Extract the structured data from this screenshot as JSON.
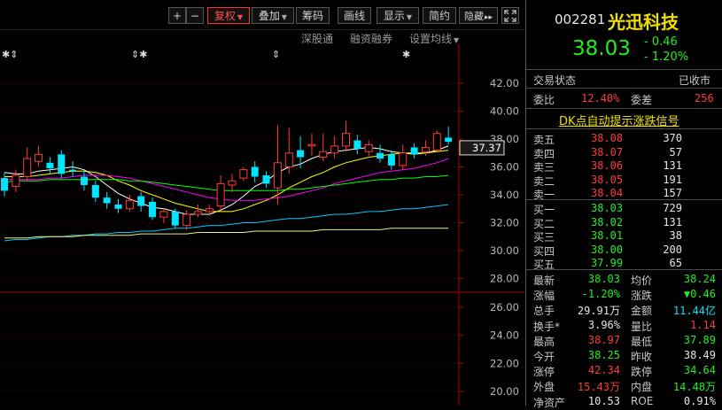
{
  "toolbar": {
    "plus": "+",
    "minus": "−",
    "fuquan": "复权",
    "diejia": "叠加",
    "chouma": "筹码",
    "huaxian": "画线",
    "xianshi": "显示",
    "jianyue": "简约",
    "yincang": "隐藏",
    "fullscreen_icon": "expand-icon"
  },
  "sublinks": {
    "shengutong": "深股通",
    "rongzi": "融资融券",
    "shezhi": "设置均线"
  },
  "markers": [
    "✱⇕",
    "⇕✱",
    "⇕",
    "✱"
  ],
  "axis": {
    "upper_ticks": [
      "42.00",
      "40.00",
      "38.00",
      "36.00",
      "34.00",
      "32.00",
      "30.00",
      "28.00"
    ],
    "lower_ticks": [
      "26.00",
      "24.00",
      "22.00",
      "20.00"
    ],
    "current_price_label": "37.37"
  },
  "chart_data": {
    "type": "candlestick",
    "ylim": [
      28,
      43
    ],
    "candles": [
      {
        "o": 35.2,
        "c": 34.3,
        "h": 35.6,
        "l": 33.9
      },
      {
        "o": 34.6,
        "c": 35.4,
        "h": 35.8,
        "l": 34.2
      },
      {
        "o": 35.3,
        "c": 36.6,
        "h": 37.4,
        "l": 35.0
      },
      {
        "o": 36.4,
        "c": 36.9,
        "h": 37.5,
        "l": 36.0
      },
      {
        "o": 36.3,
        "c": 35.9,
        "h": 36.7,
        "l": 35.5
      },
      {
        "o": 36.9,
        "c": 35.5,
        "h": 37.2,
        "l": 35.2
      },
      {
        "o": 35.8,
        "c": 35.7,
        "h": 36.4,
        "l": 35.3
      },
      {
        "o": 35.3,
        "c": 34.7,
        "h": 35.8,
        "l": 34.3
      },
      {
        "o": 34.7,
        "c": 33.8,
        "h": 35.0,
        "l": 33.5
      },
      {
        "o": 33.8,
        "c": 33.4,
        "h": 34.2,
        "l": 33.0
      },
      {
        "o": 33.3,
        "c": 33.0,
        "h": 33.7,
        "l": 32.7
      },
      {
        "o": 33.0,
        "c": 33.6,
        "h": 34.0,
        "l": 32.8
      },
      {
        "o": 33.9,
        "c": 33.2,
        "h": 34.2,
        "l": 32.8
      },
      {
        "o": 33.5,
        "c": 32.4,
        "h": 33.8,
        "l": 32.2
      },
      {
        "o": 32.4,
        "c": 32.8,
        "h": 33.0,
        "l": 32.0
      },
      {
        "o": 32.8,
        "c": 31.8,
        "h": 33.0,
        "l": 31.6
      },
      {
        "o": 31.8,
        "c": 32.6,
        "h": 32.9,
        "l": 31.5
      },
      {
        "o": 32.6,
        "c": 32.8,
        "h": 33.3,
        "l": 32.4
      },
      {
        "o": 32.8,
        "c": 33.0,
        "h": 33.3,
        "l": 32.5
      },
      {
        "o": 33.2,
        "c": 34.8,
        "h": 35.4,
        "l": 32.9
      },
      {
        "o": 34.7,
        "c": 35.0,
        "h": 35.5,
        "l": 34.2
      },
      {
        "o": 35.2,
        "c": 35.8,
        "h": 36.0,
        "l": 35.0
      },
      {
        "o": 36.0,
        "c": 35.3,
        "h": 36.4,
        "l": 34.9
      },
      {
        "o": 35.4,
        "c": 34.8,
        "h": 35.7,
        "l": 34.5
      },
      {
        "o": 34.5,
        "c": 36.3,
        "h": 39.0,
        "l": 33.3
      },
      {
        "o": 36.0,
        "c": 37.0,
        "h": 38.8,
        "l": 35.5
      },
      {
        "o": 37.2,
        "c": 36.7,
        "h": 38.2,
        "l": 35.9
      },
      {
        "o": 37.5,
        "c": 37.6,
        "h": 38.4,
        "l": 36.8
      },
      {
        "o": 36.7,
        "c": 37.1,
        "h": 38.4,
        "l": 36.4
      },
      {
        "o": 37.0,
        "c": 37.5,
        "h": 38.2,
        "l": 36.6
      },
      {
        "o": 37.5,
        "c": 38.4,
        "h": 39.3,
        "l": 37.1
      },
      {
        "o": 37.9,
        "c": 37.3,
        "h": 38.3,
        "l": 36.9
      },
      {
        "o": 37.1,
        "c": 37.6,
        "h": 37.9,
        "l": 36.8
      },
      {
        "o": 37.0,
        "c": 36.6,
        "h": 37.6,
        "l": 36.3
      },
      {
        "o": 36.9,
        "c": 36.1,
        "h": 37.2,
        "l": 35.8
      },
      {
        "o": 36.1,
        "c": 37.0,
        "h": 37.6,
        "l": 35.8
      },
      {
        "o": 37.4,
        "c": 36.9,
        "h": 37.7,
        "l": 36.6
      },
      {
        "o": 37.1,
        "c": 37.4,
        "h": 37.9,
        "l": 36.8
      },
      {
        "o": 37.2,
        "c": 38.4,
        "h": 38.6,
        "l": 37.1
      },
      {
        "o": 38.1,
        "c": 37.8,
        "h": 38.9,
        "l": 37.6
      }
    ],
    "ma_lines": [
      {
        "name": "MA5",
        "color": "#ffffff",
        "values": [
          35.6,
          35.5,
          35.5,
          35.7,
          35.8,
          35.9,
          36.0,
          35.8,
          35.3,
          34.7,
          34.1,
          33.7,
          33.4,
          33.1,
          33.0,
          32.8,
          32.6,
          32.6,
          32.6,
          32.9,
          33.3,
          33.9,
          34.6,
          35.0,
          35.6,
          36.0,
          36.2,
          36.6,
          36.9,
          37.1,
          37.2,
          37.3,
          37.4,
          37.3,
          37.1,
          37.0,
          36.9,
          37.0,
          37.2,
          37.5
        ]
      },
      {
        "name": "MA10",
        "color": "#ffff00",
        "values": [
          35.3,
          35.3,
          35.3,
          35.4,
          35.5,
          35.6,
          35.7,
          35.7,
          35.6,
          35.4,
          35.0,
          34.7,
          34.3,
          34.0,
          33.7,
          33.4,
          33.2,
          33.0,
          32.8,
          32.8,
          32.8,
          33.0,
          33.3,
          33.6,
          34.0,
          34.5,
          34.9,
          35.3,
          35.6,
          36.0,
          36.3,
          36.5,
          36.7,
          36.8,
          36.9,
          37.0,
          37.0,
          37.0,
          37.1,
          37.2
        ]
      },
      {
        "name": "MA20",
        "color": "#ff00ff",
        "values": [
          35.1,
          35.1,
          35.1,
          35.1,
          35.2,
          35.2,
          35.3,
          35.4,
          35.4,
          35.4,
          35.3,
          35.2,
          35.0,
          34.8,
          34.6,
          34.4,
          34.2,
          34.0,
          33.8,
          33.7,
          33.6,
          33.6,
          33.6,
          33.7,
          33.8,
          33.9,
          34.1,
          34.3,
          34.5,
          34.8,
          35.0,
          35.2,
          35.4,
          35.6,
          35.7,
          35.8,
          35.9,
          36.1,
          36.3,
          36.6
        ]
      },
      {
        "name": "MA30",
        "color": "#00ff00",
        "values": [
          34.9,
          35.0,
          35.0,
          35.0,
          35.1,
          35.1,
          35.1,
          35.1,
          35.1,
          35.1,
          35.1,
          35.0,
          35.0,
          34.9,
          34.8,
          34.7,
          34.6,
          34.5,
          34.4,
          34.3,
          34.3,
          34.3,
          34.3,
          34.3,
          34.3,
          34.4,
          34.4,
          34.5,
          34.6,
          34.7,
          34.8,
          34.9,
          35.0,
          35.1,
          35.1,
          35.2,
          35.2,
          35.3,
          35.3,
          35.4
        ]
      },
      {
        "name": "MA60",
        "color": "#00c8ff",
        "values": [
          30.7,
          30.8,
          30.8,
          30.9,
          31.0,
          31.0,
          31.1,
          31.1,
          31.2,
          31.2,
          31.3,
          31.3,
          31.4,
          31.4,
          31.5,
          31.6,
          31.6,
          31.7,
          31.8,
          31.8,
          31.9,
          32.0,
          32.0,
          32.1,
          32.2,
          32.3,
          32.3,
          32.4,
          32.5,
          32.6,
          32.6,
          32.7,
          32.8,
          32.8,
          32.9,
          33.0,
          33.0,
          33.1,
          33.2,
          33.3
        ]
      },
      {
        "name": "MA120",
        "color": "#f0f080",
        "values": [
          30.9,
          30.9,
          30.9,
          31.0,
          31.0,
          31.0,
          31.0,
          31.1,
          31.1,
          31.1,
          31.1,
          31.1,
          31.2,
          31.2,
          31.2,
          31.2,
          31.2,
          31.3,
          31.3,
          31.3,
          31.3,
          31.3,
          31.4,
          31.4,
          31.4,
          31.4,
          31.4,
          31.4,
          31.5,
          31.5,
          31.5,
          31.5,
          31.5,
          31.5,
          31.6,
          31.6,
          31.6,
          31.6,
          31.6,
          31.6
        ]
      }
    ]
  },
  "quote": {
    "code": "002281",
    "name": "光迅科技",
    "price": "38.03",
    "change": "- 0.46",
    "change_pct": "- 1.20%",
    "status_label": "交易状态",
    "status_value": "已收市",
    "weibi_label": "委比",
    "weibi_value": "12.40%",
    "weicha_label": "委差",
    "weicha_value": "256",
    "signal_link": "DK点自动提示涨跌信号"
  },
  "sell_orders": [
    {
      "label": "卖五",
      "price": "38.08",
      "vol": "370"
    },
    {
      "label": "卖四",
      "price": "38.07",
      "vol": "57"
    },
    {
      "label": "卖三",
      "price": "38.06",
      "vol": "131"
    },
    {
      "label": "卖二",
      "price": "38.05",
      "vol": "191"
    },
    {
      "label": "卖一",
      "price": "38.04",
      "vol": "157"
    }
  ],
  "buy_orders": [
    {
      "label": "买一",
      "price": "38.03",
      "vol": "729"
    },
    {
      "label": "买二",
      "price": "38.02",
      "vol": "131"
    },
    {
      "label": "买三",
      "price": "38.01",
      "vol": "38"
    },
    {
      "label": "买四",
      "price": "38.00",
      "vol": "200"
    },
    {
      "label": "买五",
      "price": "37.99",
      "vol": "65"
    }
  ],
  "stats": [
    {
      "l1": "最新",
      "v1": "38.03",
      "c1": "green",
      "l2": "均价",
      "v2": "38.24",
      "c2": "green"
    },
    {
      "l1": "涨幅",
      "v1": "-1.20%",
      "c1": "green",
      "l2": "涨跌",
      "v2": "▼0.46",
      "c2": "green"
    },
    {
      "l1": "总手",
      "v1": "29.91万",
      "c1": "white",
      "l2": "金额",
      "v2": "11.44亿",
      "c2": "cyan"
    },
    {
      "l1": "换手*",
      "v1": "3.96%",
      "c1": "white",
      "l2": "量比",
      "v2": "1.14",
      "c2": "red"
    },
    {
      "l1": "最高",
      "v1": "38.97",
      "c1": "red",
      "l2": "最低",
      "v2": "37.89",
      "c2": "green"
    },
    {
      "l1": "今开",
      "v1": "38.25",
      "c1": "green",
      "l2": "昨收",
      "v2": "38.49",
      "c2": "white"
    },
    {
      "l1": "涨停",
      "v1": "42.34",
      "c1": "red",
      "l2": "跌停",
      "v2": "34.64",
      "c2": "green"
    },
    {
      "l1": "外盘",
      "v1": "15.43万",
      "c1": "red",
      "l2": "内盘",
      "v2": "14.48万",
      "c2": "green"
    },
    {
      "l1": "净资产",
      "v1": "10.53",
      "c1": "white",
      "l2": "ROE",
      "v2": "0.91%",
      "c2": "white"
    }
  ]
}
